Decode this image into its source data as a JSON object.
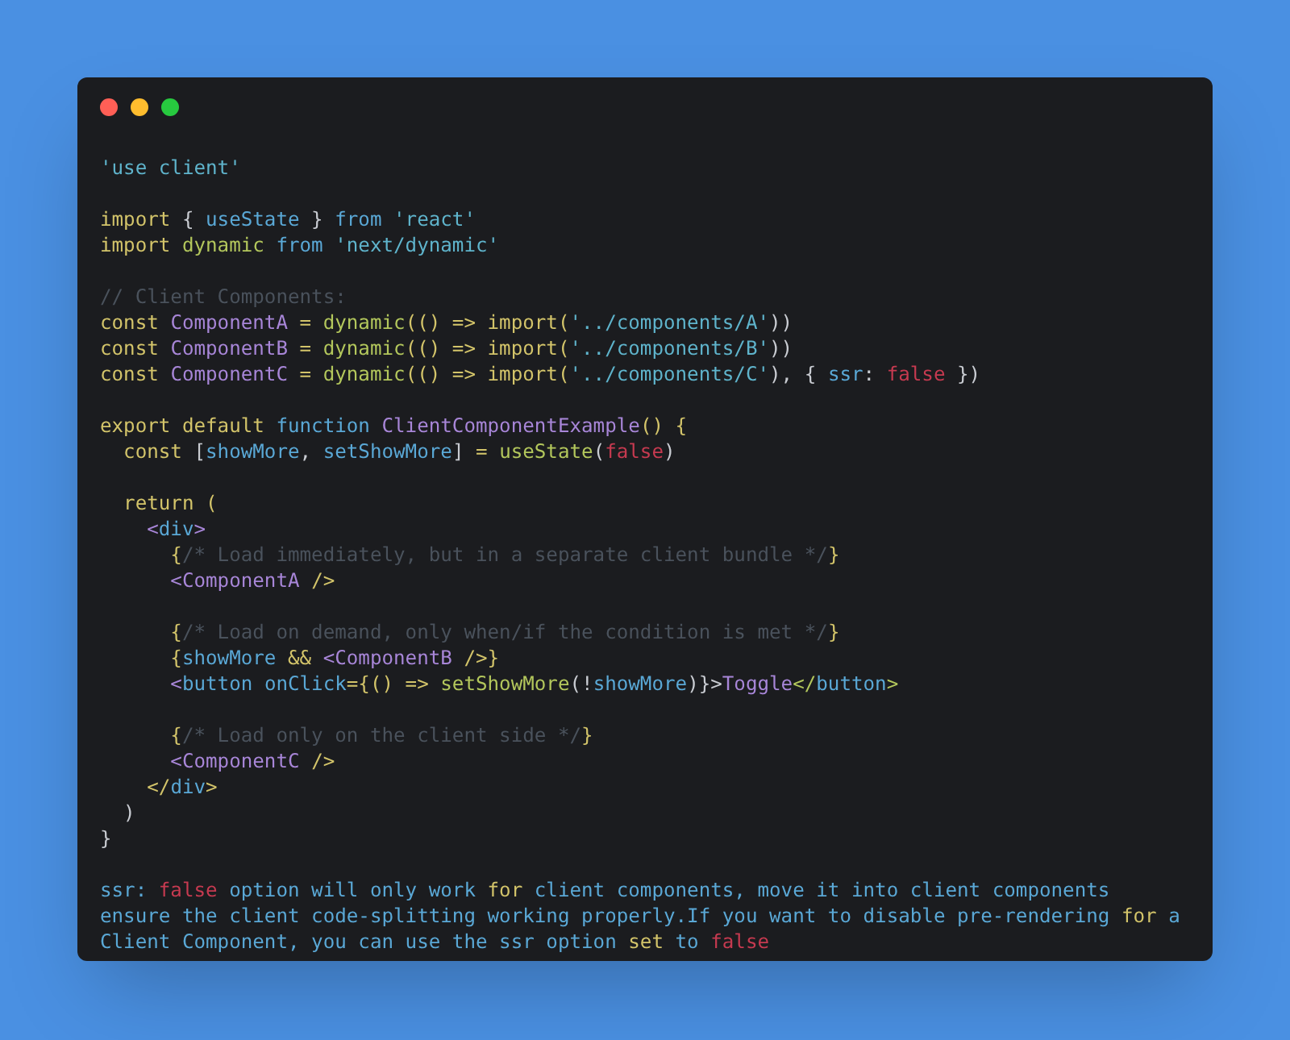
{
  "window": {
    "controls": [
      {
        "color": "#ff5f56"
      },
      {
        "color": "#ffbd2e"
      },
      {
        "color": "#27c93f"
      }
    ]
  },
  "code": [
    {
      "space_before": false,
      "tokens": [
        {
          "text": "'use client'",
          "kind": "string"
        }
      ]
    },
    {
      "space_before": true,
      "tokens": [
        {
          "text": "import ",
          "kind": "keyword"
        },
        {
          "text": "{ ",
          "kind": "plain"
        },
        {
          "text": "useState",
          "kind": "ident"
        },
        {
          "text": " } ",
          "kind": "plain"
        },
        {
          "text": "from ",
          "kind": "ident"
        },
        {
          "text": "'react'",
          "kind": "string"
        }
      ]
    },
    {
      "space_before": false,
      "tokens": [
        {
          "text": "import ",
          "kind": "keyword"
        },
        {
          "text": "dynamic ",
          "kind": "func"
        },
        {
          "text": "from ",
          "kind": "ident"
        },
        {
          "text": "'next/dynamic'",
          "kind": "string"
        }
      ]
    },
    {
      "space_before": true,
      "tokens": [
        {
          "text": "// Client Components:",
          "kind": "comment"
        }
      ]
    },
    {
      "space_before": false,
      "tokens": [
        {
          "text": "const ",
          "kind": "keyword"
        },
        {
          "text": "ComponentA",
          "kind": "component"
        },
        {
          "text": " = ",
          "kind": "keyword"
        },
        {
          "text": "dynamic",
          "kind": "func"
        },
        {
          "text": "(() => import(",
          "kind": "keyword"
        },
        {
          "text": "'../components/A'",
          "kind": "string"
        },
        {
          "text": "))",
          "kind": "plain"
        }
      ]
    },
    {
      "space_before": false,
      "tokens": [
        {
          "text": "const ",
          "kind": "keyword"
        },
        {
          "text": "ComponentB",
          "kind": "component"
        },
        {
          "text": " = ",
          "kind": "keyword"
        },
        {
          "text": "dynamic",
          "kind": "func"
        },
        {
          "text": "(() => import(",
          "kind": "keyword"
        },
        {
          "text": "'../components/B'",
          "kind": "string"
        },
        {
          "text": "))",
          "kind": "plain"
        }
      ]
    },
    {
      "space_before": false,
      "tokens": [
        {
          "text": "const ",
          "kind": "keyword"
        },
        {
          "text": "ComponentC",
          "kind": "component"
        },
        {
          "text": " = ",
          "kind": "keyword"
        },
        {
          "text": "dynamic",
          "kind": "func"
        },
        {
          "text": "(() => import(",
          "kind": "keyword"
        },
        {
          "text": "'../components/C'",
          "kind": "string"
        },
        {
          "text": "), { ",
          "kind": "plain"
        },
        {
          "text": "ssr",
          "kind": "ident"
        },
        {
          "text": ": ",
          "kind": "plain"
        },
        {
          "text": "false",
          "kind": "boolean"
        },
        {
          "text": " })",
          "kind": "plain"
        }
      ]
    },
    {
      "space_before": true,
      "tokens": [
        {
          "text": "export default ",
          "kind": "keyword"
        },
        {
          "text": "function ",
          "kind": "ident"
        },
        {
          "text": "ClientComponentExample",
          "kind": "component"
        },
        {
          "text": "() {",
          "kind": "keyword"
        }
      ]
    },
    {
      "space_before": false,
      "tokens": [
        {
          "text": "  const ",
          "kind": "keyword"
        },
        {
          "text": "[",
          "kind": "plain"
        },
        {
          "text": "showMore",
          "kind": "ident"
        },
        {
          "text": ", ",
          "kind": "plain"
        },
        {
          "text": "setShowMore",
          "kind": "ident"
        },
        {
          "text": "] ",
          "kind": "plain"
        },
        {
          "text": "= ",
          "kind": "keyword"
        },
        {
          "text": "useState",
          "kind": "func"
        },
        {
          "text": "(",
          "kind": "plain"
        },
        {
          "text": "false",
          "kind": "boolean"
        },
        {
          "text": ")",
          "kind": "plain"
        }
      ]
    },
    {
      "space_before": true,
      "tokens": [
        {
          "text": "  return (",
          "kind": "keyword"
        }
      ]
    },
    {
      "space_before": false,
      "tokens": [
        {
          "text": "    <",
          "kind": "component"
        },
        {
          "text": "div",
          "kind": "ident"
        },
        {
          "text": ">",
          "kind": "component"
        }
      ]
    },
    {
      "space_before": false,
      "tokens": [
        {
          "text": "      {",
          "kind": "keyword"
        },
        {
          "text": "/* Load immediately, but in a separate client bundle */",
          "kind": "comment"
        },
        {
          "text": "}",
          "kind": "keyword"
        }
      ]
    },
    {
      "space_before": false,
      "tokens": [
        {
          "text": "      <ComponentA ",
          "kind": "component"
        },
        {
          "text": "/>",
          "kind": "keyword"
        }
      ]
    },
    {
      "space_before": true,
      "tokens": [
        {
          "text": "      {",
          "kind": "keyword"
        },
        {
          "text": "/* Load on demand, only when/if the condition is met */",
          "kind": "comment"
        },
        {
          "text": "}",
          "kind": "keyword"
        }
      ]
    },
    {
      "space_before": false,
      "tokens": [
        {
          "text": "      {",
          "kind": "keyword"
        },
        {
          "text": "showMore ",
          "kind": "ident"
        },
        {
          "text": "&& ",
          "kind": "keyword"
        },
        {
          "text": "<ComponentB ",
          "kind": "component"
        },
        {
          "text": "/>}",
          "kind": "keyword"
        }
      ]
    },
    {
      "space_before": false,
      "tokens": [
        {
          "text": "      <",
          "kind": "component"
        },
        {
          "text": "button ",
          "kind": "ident"
        },
        {
          "text": "onClick",
          "kind": "ident"
        },
        {
          "text": "={() => ",
          "kind": "keyword"
        },
        {
          "text": "setShowMore",
          "kind": "func"
        },
        {
          "text": "(!",
          "kind": "plain"
        },
        {
          "text": "showMore",
          "kind": "ident"
        },
        {
          "text": ")}>",
          "kind": "plain"
        },
        {
          "text": "Toggle",
          "kind": "component"
        },
        {
          "text": "</",
          "kind": "func"
        },
        {
          "text": "button",
          "kind": "ident"
        },
        {
          "text": ">",
          "kind": "func"
        }
      ]
    },
    {
      "space_before": true,
      "tokens": [
        {
          "text": "      {",
          "kind": "keyword"
        },
        {
          "text": "/* Load only on the client side */",
          "kind": "comment"
        },
        {
          "text": "}",
          "kind": "keyword"
        }
      ]
    },
    {
      "space_before": false,
      "tokens": [
        {
          "text": "      <ComponentC ",
          "kind": "component"
        },
        {
          "text": "/>",
          "kind": "keyword"
        }
      ]
    },
    {
      "space_before": false,
      "tokens": [
        {
          "text": "    </",
          "kind": "keyword"
        },
        {
          "text": "div",
          "kind": "ident"
        },
        {
          "text": ">",
          "kind": "keyword"
        }
      ]
    },
    {
      "space_before": false,
      "tokens": [
        {
          "text": "  )",
          "kind": "plain"
        }
      ]
    },
    {
      "space_before": false,
      "tokens": [
        {
          "text": "}",
          "kind": "plain"
        }
      ]
    }
  ],
  "note": [
    {
      "tokens": [
        {
          "text": "ssr: ",
          "kind": "ident"
        },
        {
          "text": "false",
          "kind": "boolean"
        },
        {
          "text": " option will only work ",
          "kind": "ident"
        },
        {
          "text": "for",
          "kind": "keyword"
        },
        {
          "text": " client components, move it into client components",
          "kind": "ident"
        }
      ]
    },
    {
      "tokens": [
        {
          "text": "ensure the client code-splitting working properly.If you want to disable pre-rendering ",
          "kind": "ident"
        },
        {
          "text": "for",
          "kind": "keyword"
        },
        {
          "text": " a",
          "kind": "ident"
        }
      ]
    },
    {
      "tokens": [
        {
          "text": "Client Component, you can use the ssr option ",
          "kind": "ident"
        },
        {
          "text": "set",
          "kind": "keyword"
        },
        {
          "text": " to ",
          "kind": "ident"
        },
        {
          "text": "false",
          "kind": "boolean"
        }
      ]
    }
  ]
}
